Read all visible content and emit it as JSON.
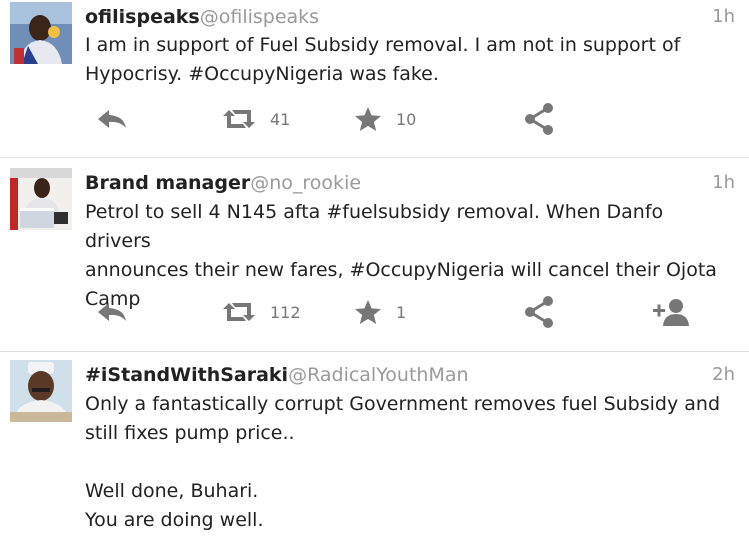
{
  "tweets": [
    {
      "name": "ofilispeaks",
      "handle": "@ofilispeaks",
      "time": "1h",
      "lines": [
        "I am in support of Fuel Subsidy removal. I am not in support of",
        "Hypocrisy. #OccupyNigeria was fake."
      ],
      "retweets": "41",
      "favorites": "10"
    },
    {
      "name": "Brand manager",
      "handle": "@no_rookie",
      "time": "1h",
      "lines": [
        "Petrol to sell 4 N145 afta #fuelsubsidy removal. When Danfo drivers",
        "announces their new fares, #OccupyNigeria will cancel their Ojota",
        "Camp"
      ],
      "retweets": "112",
      "favorites": "1"
    },
    {
      "name": "#iStandWithSaraki",
      "handle": "@RadicalYouthMan",
      "time": "2h",
      "lines": [
        "Only a fantastically corrupt Government removes fuel Subsidy and",
        "still fixes pump price..",
        "Well done, Buhari.",
        "You are doing well."
      ]
    }
  ],
  "icons": {
    "reply": "reply-icon",
    "retweet": "retweet-icon",
    "favorite": "star-icon",
    "share": "share-icon",
    "follow": "follow-icon"
  },
  "colors": {
    "icon_gray": "#777777",
    "handle_gray": "#9a9a9a",
    "divider": "#e1e1e1"
  }
}
